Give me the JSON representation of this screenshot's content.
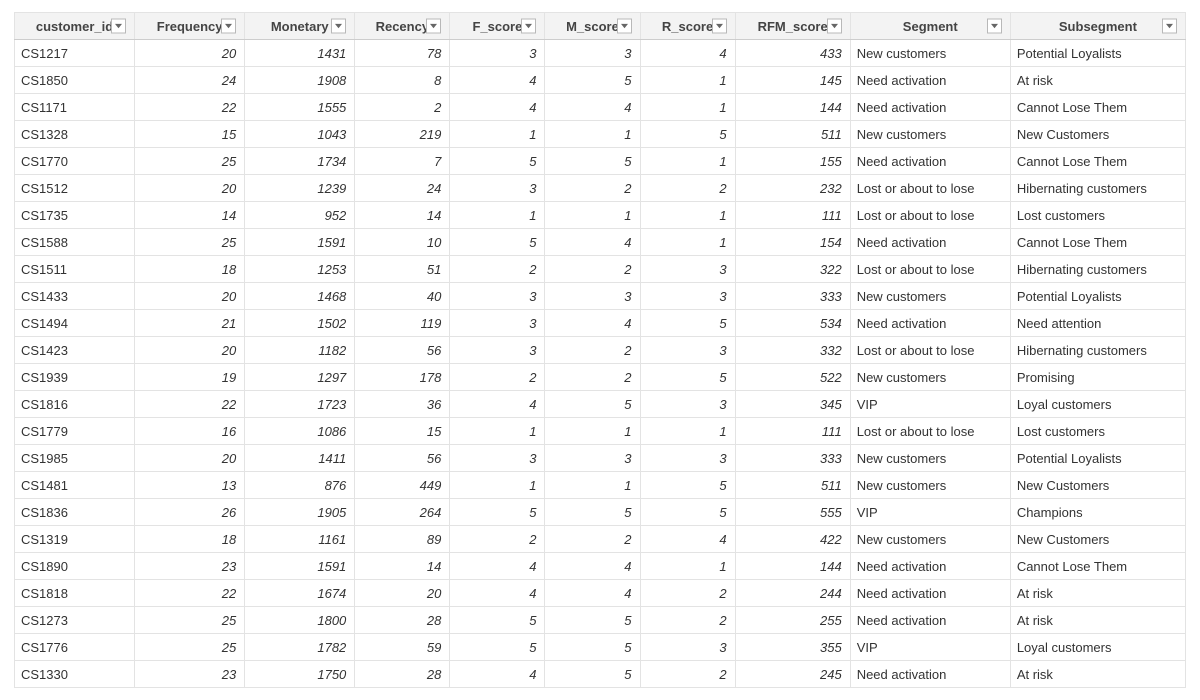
{
  "table": {
    "columns": [
      {
        "key": "customer_id",
        "label": "customer_id",
        "type": "txt"
      },
      {
        "key": "Frequency",
        "label": "Frequency",
        "type": "num"
      },
      {
        "key": "Monetary",
        "label": "Monetary",
        "type": "num"
      },
      {
        "key": "Recency",
        "label": "Recency",
        "type": "num"
      },
      {
        "key": "F_score",
        "label": "F_score",
        "type": "num"
      },
      {
        "key": "M_score",
        "label": "M_score",
        "type": "num"
      },
      {
        "key": "R_score",
        "label": "R_score",
        "type": "num"
      },
      {
        "key": "RFM_score",
        "label": "RFM_score",
        "type": "num"
      },
      {
        "key": "Segment",
        "label": "Segment",
        "type": "txt"
      },
      {
        "key": "Subsegment",
        "label": "Subsegment",
        "type": "txt"
      }
    ],
    "rows": [
      {
        "customer_id": "CS1217",
        "Frequency": "20",
        "Monetary": "1431",
        "Recency": "78",
        "F_score": "3",
        "M_score": "3",
        "R_score": "4",
        "RFM_score": "433",
        "Segment": "New customers",
        "Subsegment": "Potential Loyalists"
      },
      {
        "customer_id": "CS1850",
        "Frequency": "24",
        "Monetary": "1908",
        "Recency": "8",
        "F_score": "4",
        "M_score": "5",
        "R_score": "1",
        "RFM_score": "145",
        "Segment": "Need activation",
        "Subsegment": "At risk"
      },
      {
        "customer_id": "CS1171",
        "Frequency": "22",
        "Monetary": "1555",
        "Recency": "2",
        "F_score": "4",
        "M_score": "4",
        "R_score": "1",
        "RFM_score": "144",
        "Segment": "Need activation",
        "Subsegment": "Cannot Lose Them"
      },
      {
        "customer_id": "CS1328",
        "Frequency": "15",
        "Monetary": "1043",
        "Recency": "219",
        "F_score": "1",
        "M_score": "1",
        "R_score": "5",
        "RFM_score": "511",
        "Segment": "New customers",
        "Subsegment": "New Customers"
      },
      {
        "customer_id": "CS1770",
        "Frequency": "25",
        "Monetary": "1734",
        "Recency": "7",
        "F_score": "5",
        "M_score": "5",
        "R_score": "1",
        "RFM_score": "155",
        "Segment": "Need activation",
        "Subsegment": "Cannot Lose Them"
      },
      {
        "customer_id": "CS1512",
        "Frequency": "20",
        "Monetary": "1239",
        "Recency": "24",
        "F_score": "3",
        "M_score": "2",
        "R_score": "2",
        "RFM_score": "232",
        "Segment": "Lost or about to lose",
        "Subsegment": "Hibernating customers"
      },
      {
        "customer_id": "CS1735",
        "Frequency": "14",
        "Monetary": "952",
        "Recency": "14",
        "F_score": "1",
        "M_score": "1",
        "R_score": "1",
        "RFM_score": "111",
        "Segment": "Lost or about to lose",
        "Subsegment": "Lost customers"
      },
      {
        "customer_id": "CS1588",
        "Frequency": "25",
        "Monetary": "1591",
        "Recency": "10",
        "F_score": "5",
        "M_score": "4",
        "R_score": "1",
        "RFM_score": "154",
        "Segment": "Need activation",
        "Subsegment": "Cannot Lose Them"
      },
      {
        "customer_id": "CS1511",
        "Frequency": "18",
        "Monetary": "1253",
        "Recency": "51",
        "F_score": "2",
        "M_score": "2",
        "R_score": "3",
        "RFM_score": "322",
        "Segment": "Lost or about to lose",
        "Subsegment": "Hibernating customers"
      },
      {
        "customer_id": "CS1433",
        "Frequency": "20",
        "Monetary": "1468",
        "Recency": "40",
        "F_score": "3",
        "M_score": "3",
        "R_score": "3",
        "RFM_score": "333",
        "Segment": "New customers",
        "Subsegment": "Potential Loyalists"
      },
      {
        "customer_id": "CS1494",
        "Frequency": "21",
        "Monetary": "1502",
        "Recency": "119",
        "F_score": "3",
        "M_score": "4",
        "R_score": "5",
        "RFM_score": "534",
        "Segment": "Need activation",
        "Subsegment": "Need attention"
      },
      {
        "customer_id": "CS1423",
        "Frequency": "20",
        "Monetary": "1182",
        "Recency": "56",
        "F_score": "3",
        "M_score": "2",
        "R_score": "3",
        "RFM_score": "332",
        "Segment": "Lost or about to lose",
        "Subsegment": "Hibernating customers"
      },
      {
        "customer_id": "CS1939",
        "Frequency": "19",
        "Monetary": "1297",
        "Recency": "178",
        "F_score": "2",
        "M_score": "2",
        "R_score": "5",
        "RFM_score": "522",
        "Segment": "New customers",
        "Subsegment": "Promising"
      },
      {
        "customer_id": "CS1816",
        "Frequency": "22",
        "Monetary": "1723",
        "Recency": "36",
        "F_score": "4",
        "M_score": "5",
        "R_score": "3",
        "RFM_score": "345",
        "Segment": "VIP",
        "Subsegment": "Loyal customers"
      },
      {
        "customer_id": "CS1779",
        "Frequency": "16",
        "Monetary": "1086",
        "Recency": "15",
        "F_score": "1",
        "M_score": "1",
        "R_score": "1",
        "RFM_score": "111",
        "Segment": "Lost or about to lose",
        "Subsegment": "Lost customers"
      },
      {
        "customer_id": "CS1985",
        "Frequency": "20",
        "Monetary": "1411",
        "Recency": "56",
        "F_score": "3",
        "M_score": "3",
        "R_score": "3",
        "RFM_score": "333",
        "Segment": "New customers",
        "Subsegment": "Potential Loyalists"
      },
      {
        "customer_id": "CS1481",
        "Frequency": "13",
        "Monetary": "876",
        "Recency": "449",
        "F_score": "1",
        "M_score": "1",
        "R_score": "5",
        "RFM_score": "511",
        "Segment": "New customers",
        "Subsegment": "New Customers"
      },
      {
        "customer_id": "CS1836",
        "Frequency": "26",
        "Monetary": "1905",
        "Recency": "264",
        "F_score": "5",
        "M_score": "5",
        "R_score": "5",
        "RFM_score": "555",
        "Segment": "VIP",
        "Subsegment": "Champions"
      },
      {
        "customer_id": "CS1319",
        "Frequency": "18",
        "Monetary": "1161",
        "Recency": "89",
        "F_score": "2",
        "M_score": "2",
        "R_score": "4",
        "RFM_score": "422",
        "Segment": "New customers",
        "Subsegment": "New Customers"
      },
      {
        "customer_id": "CS1890",
        "Frequency": "23",
        "Monetary": "1591",
        "Recency": "14",
        "F_score": "4",
        "M_score": "4",
        "R_score": "1",
        "RFM_score": "144",
        "Segment": "Need activation",
        "Subsegment": "Cannot Lose Them"
      },
      {
        "customer_id": "CS1818",
        "Frequency": "22",
        "Monetary": "1674",
        "Recency": "20",
        "F_score": "4",
        "M_score": "4",
        "R_score": "2",
        "RFM_score": "244",
        "Segment": "Need activation",
        "Subsegment": "At risk"
      },
      {
        "customer_id": "CS1273",
        "Frequency": "25",
        "Monetary": "1800",
        "Recency": "28",
        "F_score": "5",
        "M_score": "5",
        "R_score": "2",
        "RFM_score": "255",
        "Segment": "Need activation",
        "Subsegment": "At risk"
      },
      {
        "customer_id": "CS1776",
        "Frequency": "25",
        "Monetary": "1782",
        "Recency": "59",
        "F_score": "5",
        "M_score": "5",
        "R_score": "3",
        "RFM_score": "355",
        "Segment": "VIP",
        "Subsegment": "Loyal customers"
      },
      {
        "customer_id": "CS1330",
        "Frequency": "23",
        "Monetary": "1750",
        "Recency": "28",
        "F_score": "4",
        "M_score": "5",
        "R_score": "2",
        "RFM_score": "245",
        "Segment": "Need activation",
        "Subsegment": "At risk"
      }
    ]
  }
}
